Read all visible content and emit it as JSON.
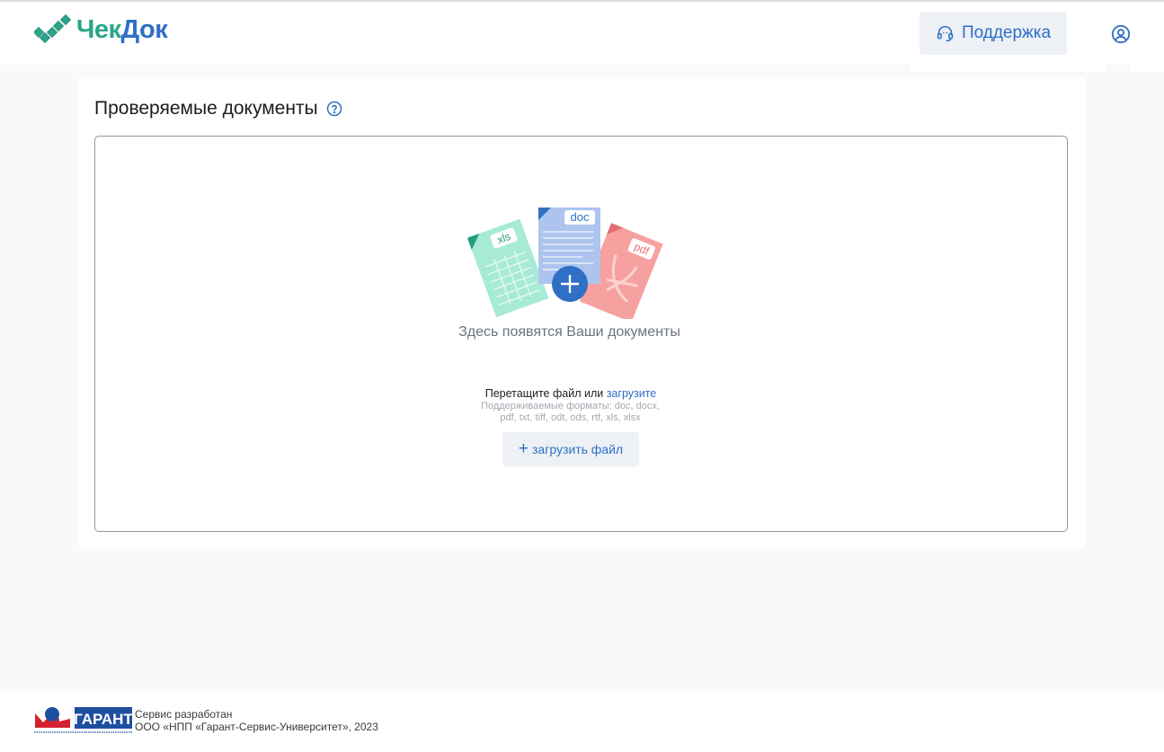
{
  "header": {
    "logo_part1": "Чек",
    "logo_part2": "Док",
    "support_label": "Поддержка"
  },
  "main": {
    "title": "Проверяемые документы",
    "dropzone": {
      "empty_text": "Здесь появятся Ваши документы",
      "drag_prefix": "Перетащите файл или",
      "drag_link": "загрузите",
      "formats_line1": "Поддерживаемые форматы: doc, docx,",
      "formats_line2": "pdf, txt, tiff, odt, ods, rtf, xls, xlsx",
      "upload_button": "загрузить файл",
      "file_labels": {
        "xls": "xls",
        "doc": "doc",
        "pdf": "pdf"
      }
    }
  },
  "footer": {
    "line1": "Сервис разработан",
    "line2": "ООО «НПП «Гарант-Сервис-Университет»,  2023",
    "garant_logo_text": "ГАРАНТ"
  },
  "colors": {
    "brand_green": "#2aa58a",
    "brand_blue": "#2f6fc4",
    "button_bg": "#edf1f5",
    "page_bg": "#f8f9fa"
  },
  "icons": [
    "checkmark-logo-icon",
    "headset-icon",
    "user-circle-icon",
    "help-circle-icon",
    "plus-icon"
  ]
}
